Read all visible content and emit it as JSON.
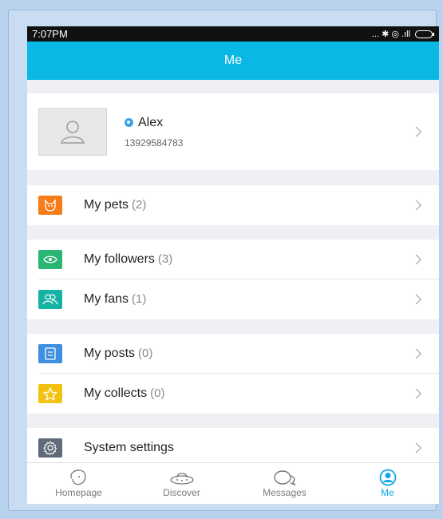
{
  "status": {
    "time": "7:07PM",
    "icons": "... ✱ ◎ .ıll"
  },
  "appbar": {
    "title": "Me"
  },
  "profile": {
    "name": "Alex",
    "phone": "13929584783"
  },
  "rows": [
    {
      "label": "My pets",
      "count": "(2)",
      "icon": "cat-icon",
      "color": "#f57c16"
    },
    {
      "label": "My followers",
      "count": "(3)",
      "icon": "eye-icon",
      "color": "#2bb673"
    },
    {
      "label": "My fans",
      "count": "(1)",
      "icon": "users-icon",
      "color": "#15b3a4"
    },
    {
      "label": "My posts",
      "count": "(0)",
      "icon": "document-icon",
      "color": "#3f8fe0"
    },
    {
      "label": "My collects",
      "count": "(0)",
      "icon": "star-icon",
      "color": "#f2c112"
    },
    {
      "label": "System settings",
      "count": "",
      "icon": "gear-icon",
      "color": "#5f6b7a"
    }
  ],
  "tabs": [
    {
      "label": "Homepage",
      "icon": "dog-icon",
      "active": false
    },
    {
      "label": "Discover",
      "icon": "ufo-icon",
      "active": false
    },
    {
      "label": "Messages",
      "icon": "chat-icon",
      "active": false
    },
    {
      "label": "Me",
      "icon": "person-icon",
      "active": true
    }
  ],
  "colors": {
    "accent": "#0ab8e6",
    "active_tab": "#10a6e8"
  }
}
